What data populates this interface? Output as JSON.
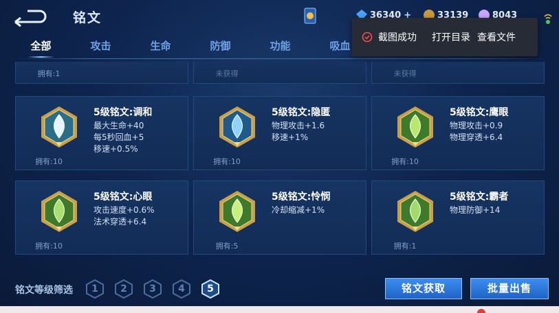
{
  "header": {
    "title": "铭文",
    "currencies": [
      {
        "icon": "diamond-icon",
        "value": "36340",
        "color": "#4aa3ff"
      },
      {
        "icon": "gold-coin-icon",
        "value": "33139",
        "color": "#c99a3d"
      },
      {
        "icon": "crystal-icon",
        "value": "8043",
        "color": "#c9a5ff"
      }
    ]
  },
  "tabs": [
    {
      "label": "全部",
      "active": true
    },
    {
      "label": "攻击"
    },
    {
      "label": "生命"
    },
    {
      "label": "防御"
    },
    {
      "label": "功能"
    },
    {
      "label": "吸血"
    }
  ],
  "toast": {
    "message": "截图成功",
    "open_dir": "打开目录",
    "view_file": "查看文件"
  },
  "top_row": [
    {
      "owned": "拥有:1"
    },
    {
      "owned": "未获得"
    },
    {
      "owned": "未获得"
    }
  ],
  "runes": [
    {
      "name": "5级铭文:调和",
      "attrs": [
        "最大生命+40",
        "每5秒回血+5",
        "移速+0.5%"
      ],
      "owned": "拥有:10",
      "gem": "#e8f6ff",
      "frame": "#c9a04a",
      "inner": "#2b6e8a"
    },
    {
      "name": "5级铭文:隐匿",
      "attrs": [
        "物理攻击+1.6",
        "移速+1%"
      ],
      "owned": "拥有:10",
      "gem": "#8fd4ff",
      "frame": "#c9a04a",
      "inner": "#1f5a8c"
    },
    {
      "name": "5级铭文:鹰眼",
      "attrs": [
        "物理攻击+0.9",
        "物理穿透+6.4"
      ],
      "owned": "拥有:10",
      "gem": "#b9e86a",
      "frame": "#c9a04a",
      "inner": "#3e7a2a"
    },
    {
      "name": "5级铭文:心眼",
      "attrs": [
        "攻击速度+0.6%",
        "法术穿透+6.4"
      ],
      "owned": "拥有:10",
      "gem": "#a8e070",
      "frame": "#c9a04a",
      "inner": "#3e7a2a"
    },
    {
      "name": "5级铭文:怜悯",
      "attrs": [
        "冷却缩减+1%"
      ],
      "owned": "拥有:5",
      "gem": "#c8f07a",
      "frame": "#c9a04a",
      "inner": "#3e7a2a"
    },
    {
      "name": "5级铭文:霸者",
      "attrs": [
        "物理防御+14"
      ],
      "owned": "拥有:1",
      "gem": "#9fdc6a",
      "frame": "#c9a04a",
      "inner": "#3e7a2a"
    }
  ],
  "bottom": {
    "filter_label": "铭文等级筛选",
    "levels": [
      "1",
      "2",
      "3",
      "4",
      "5"
    ],
    "active_level": "5",
    "acquire_button": "铭文获取",
    "bulk_sell_button": "批量出售"
  }
}
